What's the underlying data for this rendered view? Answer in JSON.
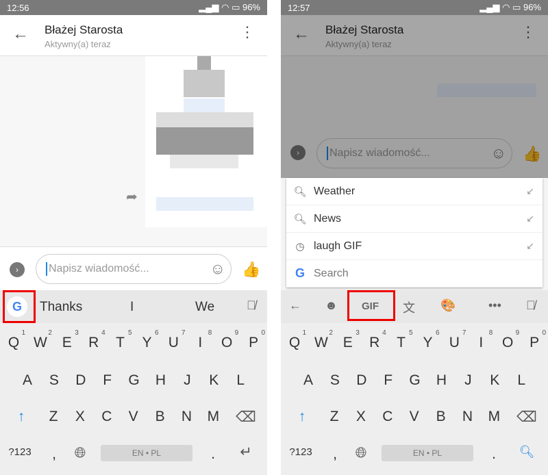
{
  "left": {
    "status": {
      "time": "12:56",
      "battery": "96%"
    },
    "header": {
      "name": "Błażej Starosta",
      "status": "Aktywny(a) teraz"
    },
    "input": {
      "placeholder": "Napisz wiadomość..."
    },
    "suggestions": [
      "Thanks",
      "I",
      "We"
    ]
  },
  "right": {
    "status": {
      "time": "12:57",
      "battery": "96%"
    },
    "header": {
      "name": "Błażej Starosta",
      "status": "Aktywny(a) teraz"
    },
    "input": {
      "placeholder": "Napisz wiadomość..."
    },
    "search_panel": [
      {
        "icon": "search-icon",
        "label": "Weather"
      },
      {
        "icon": "search-icon",
        "label": "News"
      },
      {
        "icon": "history-icon",
        "label": "laugh GIF"
      },
      {
        "icon": "google-icon",
        "label": "Search"
      }
    ],
    "toolbar": {
      "gif": "GIF"
    }
  },
  "keyboard": {
    "row1": [
      "Q",
      "W",
      "E",
      "R",
      "T",
      "Y",
      "U",
      "I",
      "O",
      "P"
    ],
    "row1_hints": [
      "1",
      "2",
      "3",
      "4",
      "5",
      "6",
      "7",
      "8",
      "9",
      "0"
    ],
    "row2": [
      "A",
      "S",
      "D",
      "F",
      "G",
      "H",
      "J",
      "K",
      "L"
    ],
    "row3": [
      "Z",
      "X",
      "C",
      "V",
      "B",
      "N",
      "M"
    ],
    "symbols": "?123",
    "comma": ",",
    "period": ".",
    "space": "EN • PL"
  },
  "colors": {
    "accent": "#1e88e5",
    "highlight": "#e00000"
  }
}
